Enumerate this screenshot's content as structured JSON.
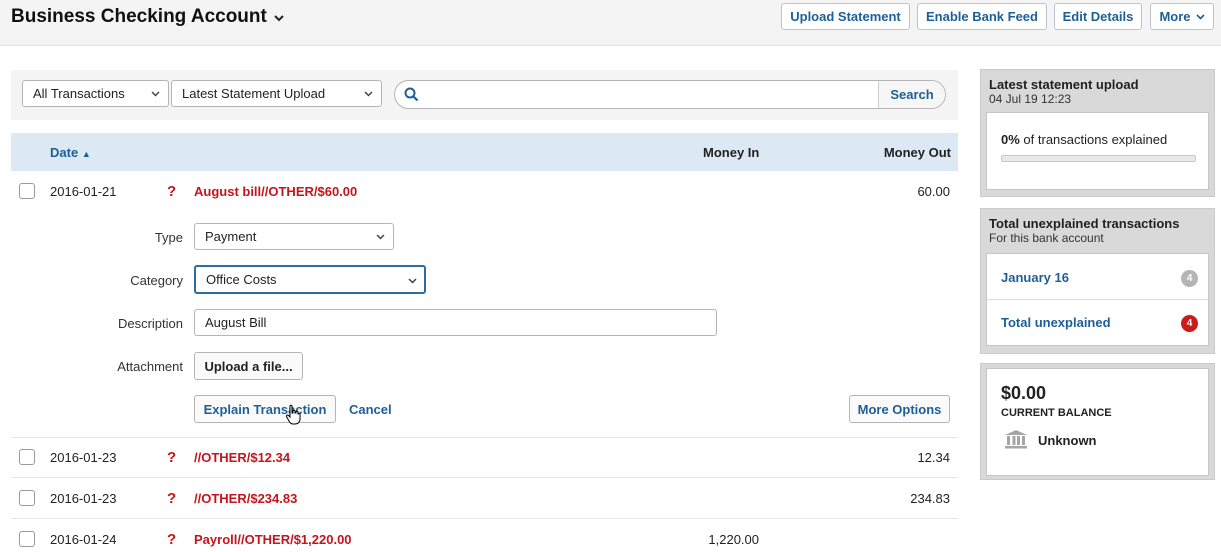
{
  "header": {
    "account_title": "Business Checking Account",
    "buttons": {
      "upload_statement": "Upload Statement",
      "enable_bank_feed": "Enable Bank Feed",
      "edit_details": "Edit Details",
      "more": "More"
    }
  },
  "filters": {
    "transactions_filter": "All Transactions",
    "statement_filter": "Latest Statement Upload",
    "search_value": "",
    "search_button": "Search"
  },
  "table": {
    "columns": {
      "date": "Date",
      "money_in": "Money In",
      "money_out": "Money Out"
    },
    "sort_indicator": "▲",
    "rows": [
      {
        "date": "2016-01-21",
        "flag": "?",
        "description": "August bill//OTHER/$60.00",
        "money_in": "",
        "money_out": "60.00"
      },
      {
        "date": "2016-01-23",
        "flag": "?",
        "description": "//OTHER/$12.34",
        "money_in": "",
        "money_out": "12.34"
      },
      {
        "date": "2016-01-23",
        "flag": "?",
        "description": "//OTHER/$234.83",
        "money_in": "",
        "money_out": "234.83"
      },
      {
        "date": "2016-01-24",
        "flag": "?",
        "description": "Payroll//OTHER/$1,220.00",
        "money_in": "1,220.00",
        "money_out": ""
      }
    ]
  },
  "explain_form": {
    "type_label": "Type",
    "type_value": "Payment",
    "category_label": "Category",
    "category_value": "Office Costs",
    "description_label": "Description",
    "description_value": "August Bill",
    "attachment_label": "Attachment",
    "upload_button": "Upload a file...",
    "explain_button": "Explain Transaction",
    "cancel_link": "Cancel",
    "more_options_button": "More Options"
  },
  "sidebar": {
    "statement": {
      "title": "Latest statement upload",
      "timestamp": "04 Jul 19 12:23",
      "percent": "0%",
      "percent_text": "of transactions explained",
      "progress": 0
    },
    "unexplained": {
      "title": "Total unexplained transactions",
      "subtitle": "For this bank account",
      "items": [
        {
          "label": "January 16",
          "count": "4",
          "badge_color": "#b5b5b5"
        },
        {
          "label": "Total unexplained",
          "count": "4",
          "badge_color": "#cc1b1b"
        }
      ]
    },
    "balance": {
      "amount": "$0.00",
      "label": "CURRENT BALANCE",
      "bank_name": "Unknown"
    }
  }
}
